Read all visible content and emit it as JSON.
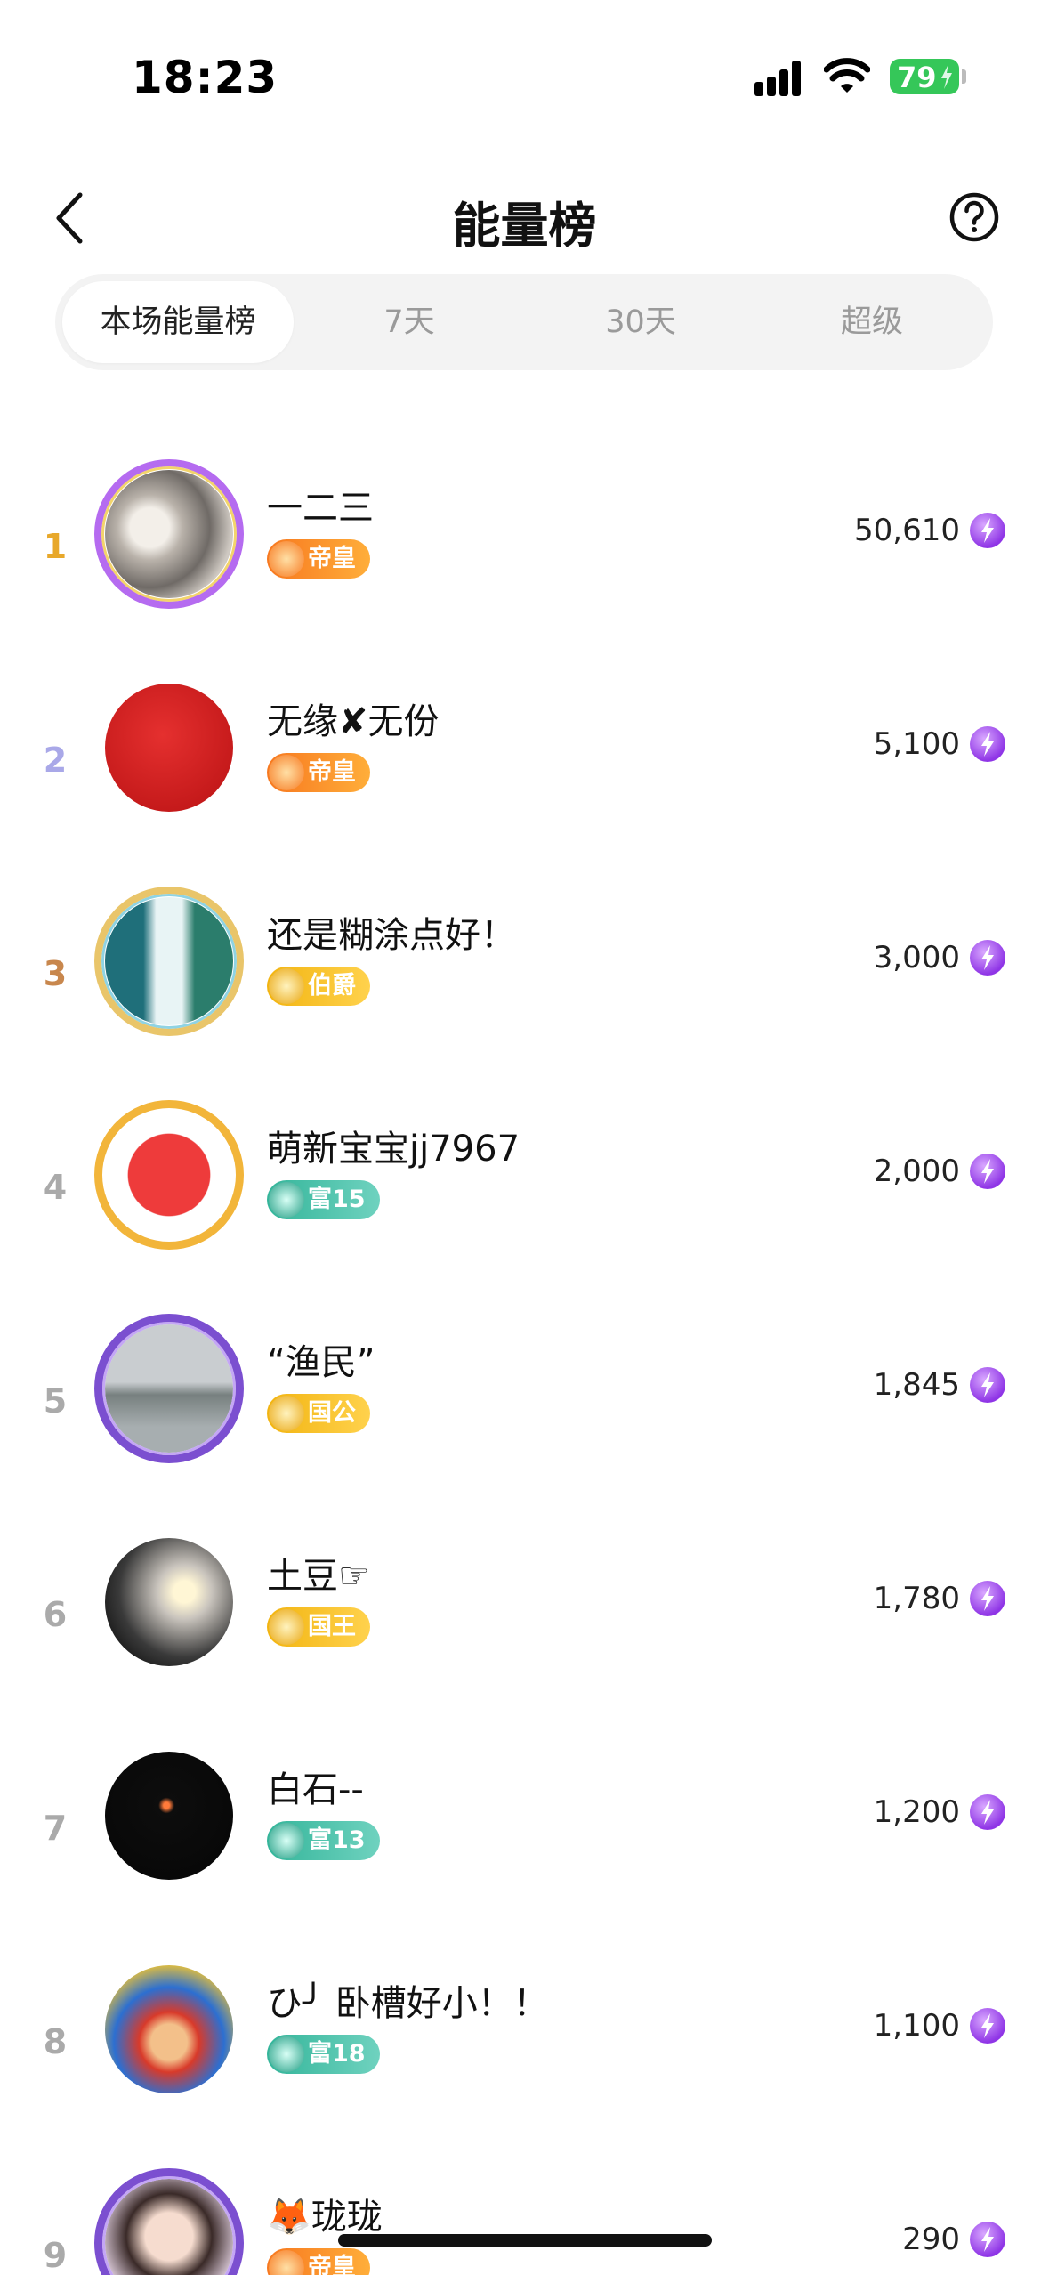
{
  "status_bar": {
    "time": "18:23",
    "battery": "79"
  },
  "header": {
    "title": "能量榜"
  },
  "tabs": [
    {
      "label": "本场能量榜",
      "active": true
    },
    {
      "label": "7天",
      "active": false
    },
    {
      "label": "30天",
      "active": false
    },
    {
      "label": "超级",
      "active": false
    }
  ],
  "ranking": [
    {
      "rank": "1",
      "name": "一二三",
      "badge": "帝皇",
      "score": "50,610"
    },
    {
      "rank": "2",
      "name": "无缘✘无份",
      "badge": "帝皇",
      "score": "5,100"
    },
    {
      "rank": "3",
      "name": "还是糊涂点好！",
      "badge": "伯爵",
      "score": "3,000"
    },
    {
      "rank": "4",
      "name": "萌新宝宝jj7967",
      "badge": "富15",
      "score": "2,000"
    },
    {
      "rank": "5",
      "name": "“渔民”",
      "badge": "国公",
      "score": "1,845"
    },
    {
      "rank": "6",
      "name": "土豆☞",
      "badge": "国王",
      "score": "1,780"
    },
    {
      "rank": "7",
      "name": "白石--",
      "badge": "富13",
      "score": "1,200"
    },
    {
      "rank": "8",
      "name": "ひ╯ 卧槽好小！！",
      "badge": "富18",
      "score": "1,100"
    },
    {
      "rank": "9",
      "name": "🦊珑珑",
      "badge": "帝皇",
      "score": "290"
    }
  ],
  "colors": {
    "rank_1": "#e8a82a",
    "rank_2": "#a9a8e8",
    "rank_3": "#c8874d",
    "badge_orange": "#f7781f",
    "badge_gold": "#f2b410",
    "badge_teal": "#34b59a",
    "energy_purple": "#8f35e6",
    "battery_green": "#35c759"
  }
}
